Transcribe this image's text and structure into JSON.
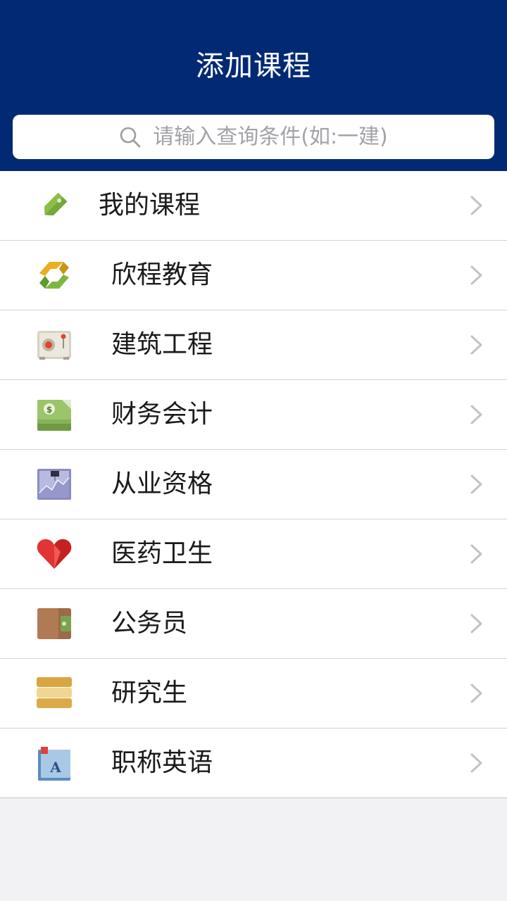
{
  "header": {
    "title": "添加课程",
    "background_color": "#022a74"
  },
  "search": {
    "placeholder": "请输入查询条件(如:一建)",
    "icon": "search-icon"
  },
  "list": {
    "items": [
      {
        "label": "我的课程",
        "icon": "tag-icon"
      },
      {
        "label": "欣程教育",
        "icon": "recycle-arrows-icon"
      },
      {
        "label": "建筑工程",
        "icon": "safe-icon"
      },
      {
        "label": "财务会计",
        "icon": "money-icon"
      },
      {
        "label": "从业资格",
        "icon": "chart-board-icon"
      },
      {
        "label": "医药卫生",
        "icon": "heart-icon"
      },
      {
        "label": "公务员",
        "icon": "wallet-icon"
      },
      {
        "label": "研究生",
        "icon": "stack-icon"
      },
      {
        "label": "职称英语",
        "icon": "dictionary-icon"
      }
    ]
  }
}
